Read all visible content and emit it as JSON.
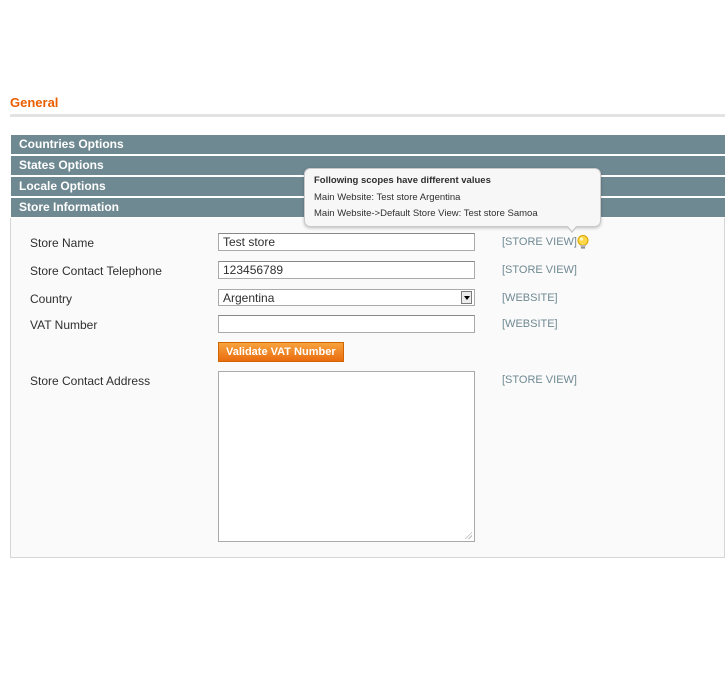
{
  "page": {
    "title": "General"
  },
  "sections": [
    {
      "label": "Countries Options"
    },
    {
      "label": "States Options"
    },
    {
      "label": "Locale Options"
    },
    {
      "label": "Store Information"
    }
  ],
  "fields": {
    "store_name": {
      "label": "Store Name",
      "value": "Test store",
      "scope": "[STORE VIEW]"
    },
    "store_phone": {
      "label": "Store Contact Telephone",
      "value": "123456789",
      "scope": "[STORE VIEW]"
    },
    "country": {
      "label": "Country",
      "value": "Argentina",
      "scope": "[WEBSITE]"
    },
    "vat_number": {
      "label": "VAT Number",
      "value": "",
      "scope": "[WEBSITE]"
    },
    "validate_button": {
      "label": "Validate VAT Number"
    },
    "store_address": {
      "label": "Store Contact Address",
      "value": "",
      "scope": "[STORE VIEW]"
    }
  },
  "tooltip": {
    "title": "Following scopes have different values",
    "lines": [
      "Main Website: Test store Argentina",
      "Main Website->Default Store View: Test store Samoa"
    ]
  },
  "icons": {
    "scope_hint": "lightbulb-icon"
  },
  "colors": {
    "accent_orange": "#eb5e00",
    "section_header": "#6f8992",
    "scope_text": "#6f8992",
    "button": "#ea6c0f"
  }
}
